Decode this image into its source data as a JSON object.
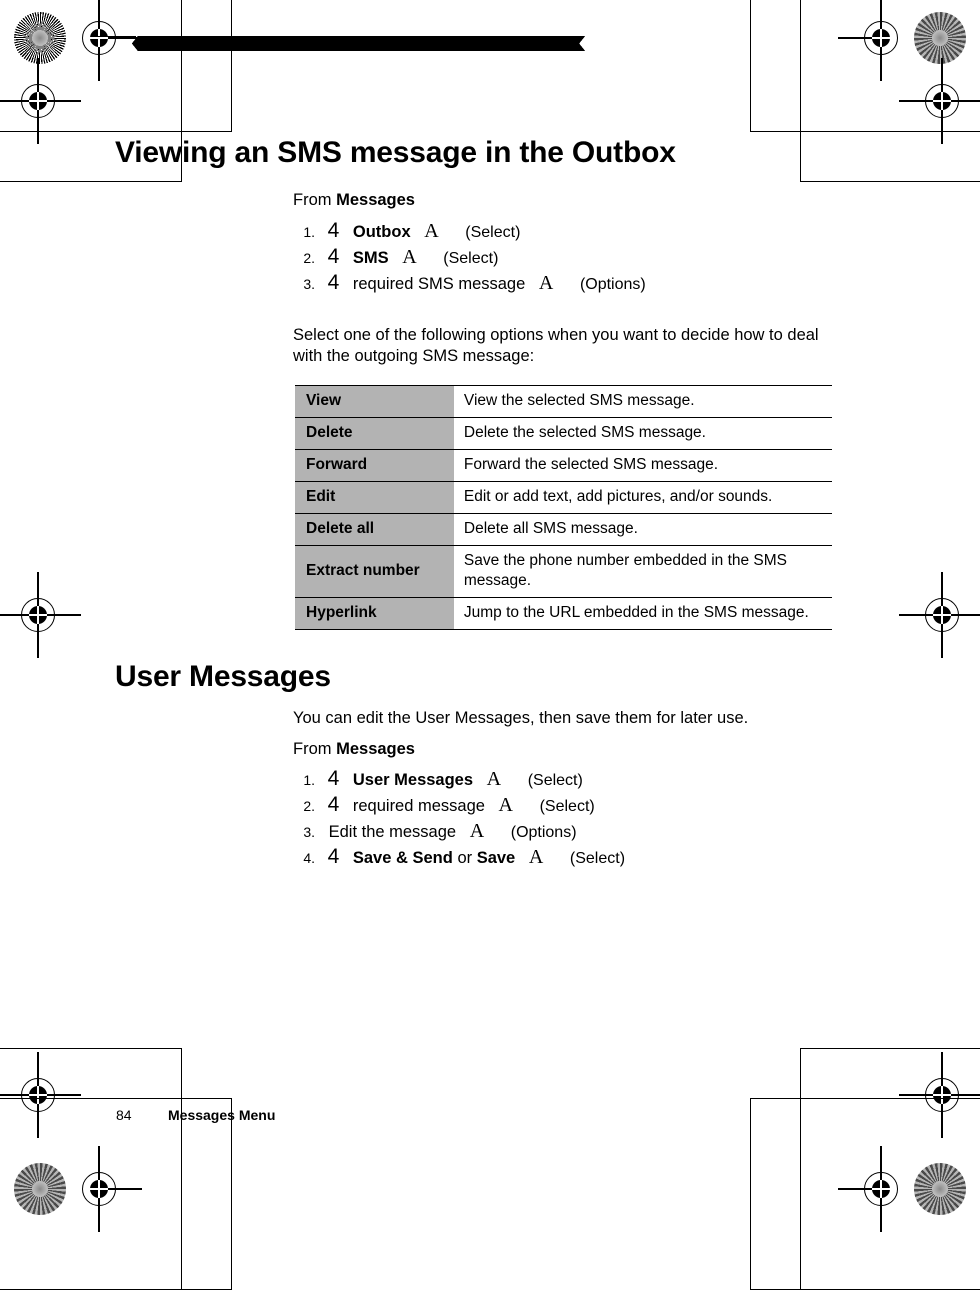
{
  "document": {
    "page_number": "84",
    "running_title": "Messages Menu"
  },
  "sections": [
    {
      "heading": "Viewing an SMS message in the Outbox",
      "intro": "From",
      "intro_bold": "Messages",
      "steps": [
        {
          "num": "1.",
          "scroll": "4",
          "label": "Outbox",
          "label_bold": true,
          "key": "A",
          "action": "(Select)"
        },
        {
          "num": "2.",
          "scroll": "4",
          "label": "SMS",
          "label_bold": true,
          "key": "A",
          "action": "(Select)"
        },
        {
          "num": "3.",
          "scroll": "4",
          "label": "required SMS message",
          "label_bold": false,
          "key": "A",
          "action": "(Options)"
        }
      ],
      "lead_in": "Select one of the following options when you want to decide how to deal with the outgoing SMS message:",
      "table": {
        "rows": [
          {
            "option": "View",
            "description": "View the selected SMS message."
          },
          {
            "option": "Delete",
            "description": "Delete the selected SMS message."
          },
          {
            "option": "Forward",
            "description": "Forward the selected SMS message."
          },
          {
            "option": "Edit",
            "description": "Edit or add text, add pictures, and/or sounds."
          },
          {
            "option": "Delete all",
            "description": "Delete all SMS message."
          },
          {
            "option": "Extract number",
            "description": "Save the phone number embedded in the SMS message."
          },
          {
            "option": "Hyperlink",
            "description": "Jump to the URL embedded in the SMS message."
          }
        ]
      }
    },
    {
      "heading": "User Messages",
      "description": "You can edit the User Messages, then save them for later use.",
      "intro": "From",
      "intro_bold": "Messages",
      "steps": [
        {
          "num": "1.",
          "scroll": "4",
          "label": "User Messages",
          "label_bold": true,
          "key": "A",
          "action": "(Select)"
        },
        {
          "num": "2.",
          "scroll": "4",
          "label": "required message",
          "label_bold": false,
          "key": "A",
          "action": "(Select)"
        },
        {
          "num": "3.",
          "scroll": "",
          "label": "Edit the message",
          "label_bold": false,
          "key": "A",
          "action": "(Options)"
        },
        {
          "num": "4.",
          "scroll": "4",
          "label_parts": [
            {
              "text": "Save & Send",
              "bold": true
            },
            {
              "text": " or ",
              "bold": false
            },
            {
              "text": "Save",
              "bold": true
            }
          ],
          "key": "A",
          "action": "(Select)"
        }
      ]
    }
  ],
  "print_marks": {
    "rosette_label": "star-target",
    "registration_label": "registration-crosshair",
    "crop_label": "crop-mark",
    "bar_label": "diamond-rule"
  },
  "colors": {
    "table_header_gray": "#b3b3b3",
    "rule_black": "#000000",
    "paper": "#ffffff"
  }
}
